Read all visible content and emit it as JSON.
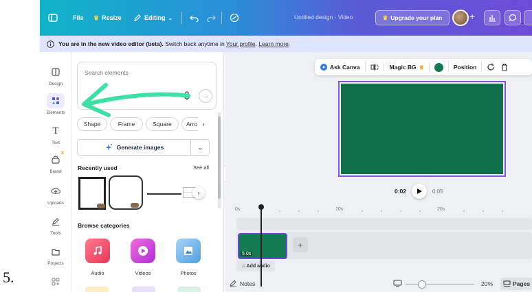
{
  "list_marker": "5.",
  "topbar": {
    "file": "File",
    "resize": "Resize",
    "editing": "Editing",
    "doc_title": "Untitled design - Video",
    "upgrade": "Upgrade your plan",
    "plus": "+"
  },
  "banner": {
    "text_bold": "You are in the new video editor (beta).",
    "text": " Switch back anytime in ",
    "link_profile": "Your profile",
    "dot": ". ",
    "link_learn": "Learn more",
    "end": "."
  },
  "rail": {
    "items": [
      {
        "label": "Design",
        "icon": "layout-icon"
      },
      {
        "label": "Elements",
        "icon": "shapes-icon"
      },
      {
        "label": "Text",
        "icon": "text-icon"
      },
      {
        "label": "Brand",
        "icon": "brand-icon"
      },
      {
        "label": "Uploads",
        "icon": "upload-icon"
      },
      {
        "label": "Tools",
        "icon": "pen-icon"
      },
      {
        "label": "Projects",
        "icon": "folder-icon"
      },
      {
        "label": "",
        "icon": "apps-icon"
      }
    ]
  },
  "panel": {
    "search_placeholder": "Search elements",
    "chips": [
      "Shape",
      "Frame",
      "Square",
      "Arro"
    ],
    "generate": "Generate images",
    "recently_used": "Recently used",
    "see_all": "See all",
    "browse": "Browse categories",
    "categories": [
      {
        "label": "Audio",
        "color": "#f0506e"
      },
      {
        "label": "Videos",
        "color": "#d63ad6"
      },
      {
        "label": "Photos",
        "color": "#6fb3e8"
      }
    ]
  },
  "canvas": {
    "ask_canva": "Ask Canva",
    "magic_bg": "Magic BG",
    "position": "Position",
    "page_color": "#11714c",
    "current_time": "0:02",
    "total_time": "0:05"
  },
  "timeline": {
    "ticks": [
      "0s",
      "10s",
      "20s"
    ],
    "clip_label": "5.0s",
    "add_audio": "Add audio"
  },
  "footer": {
    "notes": "Notes",
    "zoom": "20%",
    "pages": "Pages"
  }
}
